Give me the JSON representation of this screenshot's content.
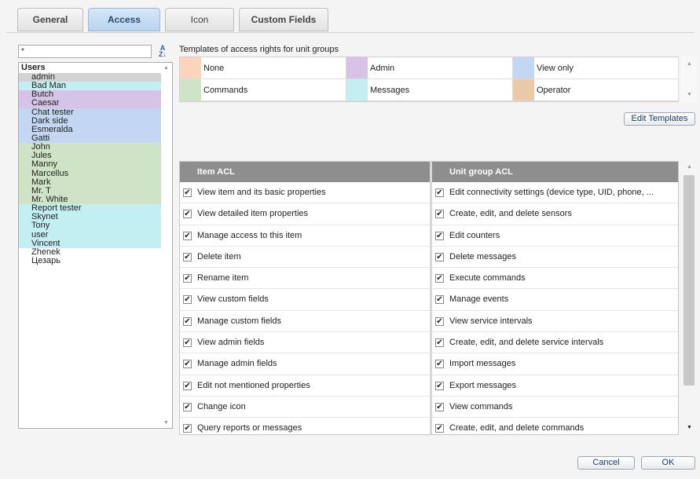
{
  "tabs": [
    "General",
    "Access",
    "Icon",
    "Custom Fields"
  ],
  "filter": {
    "value": "*"
  },
  "users": {
    "header": "Users",
    "items": [
      {
        "name": "admin",
        "color": "#d3d3d3"
      },
      {
        "name": "Bad Man",
        "color": "#c3eef2"
      },
      {
        "name": "Butch",
        "color": "#d8c3e8"
      },
      {
        "name": "Caesar",
        "color": "#d8c3e8"
      },
      {
        "name": "Chat tester",
        "color": "#c3d6f2"
      },
      {
        "name": "Dark side",
        "color": "#c3d6f2"
      },
      {
        "name": "Esmeralda",
        "color": "#c3d6f2"
      },
      {
        "name": "Gatti",
        "color": "#c3d6f2"
      },
      {
        "name": "John",
        "color": "#cfe4c6"
      },
      {
        "name": "Jules",
        "color": "#cfe4c6"
      },
      {
        "name": "Manny",
        "color": "#cfe4c6"
      },
      {
        "name": "Marcellus",
        "color": "#cfe4c6"
      },
      {
        "name": "Mark",
        "color": "#cfe4c6"
      },
      {
        "name": "Mr. T",
        "color": "#cfe4c6"
      },
      {
        "name": "Mr. White",
        "color": "#cfe4c6"
      },
      {
        "name": "Report tester",
        "color": "#c3eef2"
      },
      {
        "name": "Skynet",
        "color": "#c3eef2"
      },
      {
        "name": "Tony",
        "color": "#c3eef2"
      },
      {
        "name": "user",
        "color": "#c3eef2"
      },
      {
        "name": "Vincent",
        "color": "#c3eef2"
      },
      {
        "name": "Zhenek",
        "color": "#ffffff"
      },
      {
        "name": "Цезарь",
        "color": "#ffffff"
      }
    ]
  },
  "templates": {
    "title": "Templates of access rights for unit groups",
    "items": [
      {
        "label": "None",
        "color": "#fbd4bd"
      },
      {
        "label": "Admin",
        "color": "#d8c3e8"
      },
      {
        "label": "View only",
        "color": "#c3d6f2"
      },
      {
        "label": "Commands",
        "color": "#cfe4c6"
      },
      {
        "label": "Messages",
        "color": "#c3eef2"
      },
      {
        "label": "Operator",
        "color": "#ebc9a6"
      }
    ],
    "edit_label": "Edit Templates"
  },
  "acl": {
    "item_header": "Item ACL",
    "unit_header": "Unit group ACL",
    "check_glyph": "✔",
    "item_rows": [
      "View item and its basic properties",
      "View detailed item properties",
      "Manage access to this item",
      "Delete item",
      "Rename item",
      "View custom fields",
      "Manage custom fields",
      "View admin fields",
      "Manage admin fields",
      "Edit not mentioned properties",
      "Change icon",
      "Query reports or messages"
    ],
    "unit_rows": [
      "Edit connectivity settings (device type, UID, phone, ...",
      "Create, edit, and delete sensors",
      "Edit counters",
      "Delete messages",
      "Execute commands",
      "Manage events",
      "View service intervals",
      "Create, edit, and delete service intervals",
      "Import messages",
      "Export messages",
      "View commands",
      "Create, edit, and delete commands"
    ]
  },
  "footer": {
    "cancel_label": "Cancel",
    "ok_label": "OK"
  }
}
